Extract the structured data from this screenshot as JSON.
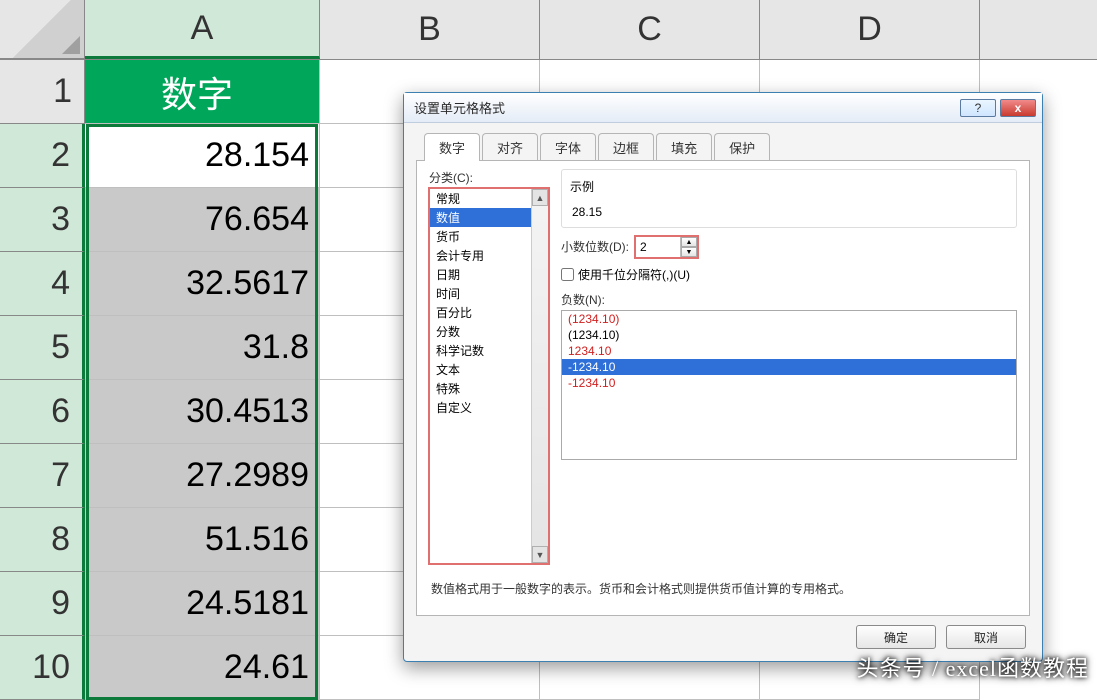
{
  "sheet": {
    "columns": [
      "A",
      "B",
      "C",
      "D"
    ],
    "rows": [
      "1",
      "2",
      "3",
      "4",
      "5",
      "6",
      "7",
      "8",
      "9",
      "10"
    ],
    "header_cell": "数字",
    "dataA": [
      "28.154",
      "76.654",
      "32.5617",
      "31.8",
      "30.4513",
      "27.2989",
      "51.516",
      "24.5181",
      "24.61"
    ]
  },
  "dialog": {
    "title": "设置单元格格式",
    "help_icon": "?",
    "close_icon": "x",
    "tabs": [
      "数字",
      "对齐",
      "字体",
      "边框",
      "填充",
      "保护"
    ],
    "category_label": "分类(C):",
    "categories": [
      "常规",
      "数值",
      "货币",
      "会计专用",
      "日期",
      "时间",
      "百分比",
      "分数",
      "科学记数",
      "文本",
      "特殊",
      "自定义"
    ],
    "category_selected_index": 1,
    "sample_label": "示例",
    "sample_value": "28.15",
    "decimal_label": "小数位数(D):",
    "decimal_value": "2",
    "thousands_label": "使用千位分隔符(,)(U)",
    "thousands_checked": false,
    "negative_label": "负数(N):",
    "negatives": [
      {
        "text": "(1234.10)",
        "color": "red"
      },
      {
        "text": "(1234.10)",
        "color": "blk"
      },
      {
        "text": "1234.10",
        "color": "red"
      },
      {
        "text": "-1234.10",
        "color": "blk",
        "selected": true
      },
      {
        "text": "-1234.10",
        "color": "red"
      }
    ],
    "description": "数值格式用于一般数字的表示。货币和会计格式则提供货币值计算的专用格式。",
    "ok": "确定",
    "cancel": "取消"
  },
  "watermark": "头条号 / excel函数教程"
}
